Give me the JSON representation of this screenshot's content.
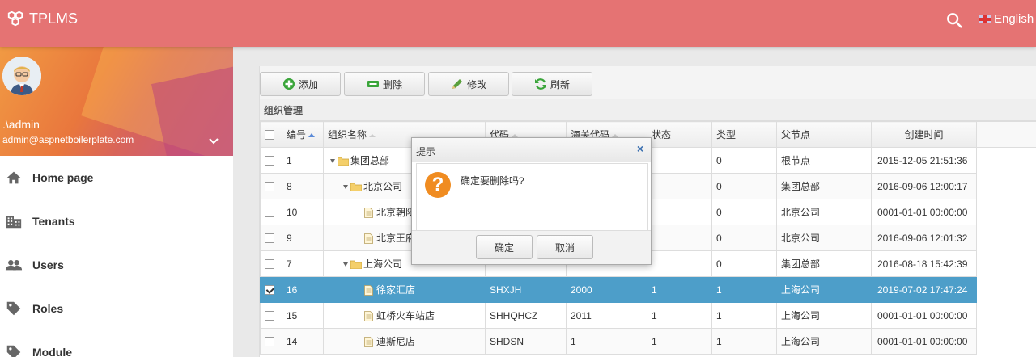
{
  "topbar": {
    "app_title": "TPLMS",
    "language": "English"
  },
  "user": {
    "name": ".\\admin",
    "email": "admin@aspnetboilerplate.com"
  },
  "menu": [
    {
      "label": "Home page",
      "icon": "home-icon"
    },
    {
      "label": "Tenants",
      "icon": "building-icon"
    },
    {
      "label": "Users",
      "icon": "users-icon"
    },
    {
      "label": "Roles",
      "icon": "tag-icon"
    },
    {
      "label": "Module",
      "icon": "tag-icon"
    }
  ],
  "toolbar": {
    "add": "添加",
    "delete": "删除",
    "edit": "修改",
    "refresh": "刷新"
  },
  "panel_title": "组织管理",
  "grid": {
    "columns": [
      "编号",
      "组织名称",
      "代码",
      "海关代码",
      "状态",
      "类型",
      "父节点",
      "创建时间"
    ],
    "rows": [
      {
        "id": "1",
        "name": "集团总部",
        "code": "",
        "customs": "",
        "status": "",
        "type": "0",
        "parent": "根节点",
        "created": "2015-12-05 21:51:36",
        "checked": false
      },
      {
        "id": "8",
        "name": "北京公司",
        "code": "",
        "customs": "",
        "status": "",
        "type": "0",
        "parent": "集团总部",
        "created": "2016-09-06 12:00:17",
        "checked": false
      },
      {
        "id": "10",
        "name": "北京朝阳",
        "code": "",
        "customs": "",
        "status": "",
        "type": "0",
        "parent": "北京公司",
        "created": "0001-01-01 00:00:00",
        "checked": false
      },
      {
        "id": "9",
        "name": "北京王府",
        "code": "",
        "customs": "",
        "status": "",
        "type": "0",
        "parent": "北京公司",
        "created": "2016-09-06 12:01:32",
        "checked": false
      },
      {
        "id": "7",
        "name": "上海公司",
        "code": "",
        "customs": "",
        "status": "",
        "type": "0",
        "parent": "集团总部",
        "created": "2016-08-18 15:42:39",
        "checked": false
      },
      {
        "id": "16",
        "name": "徐家汇店",
        "code": "SHXJH",
        "customs": "2000",
        "status": "1",
        "type": "1",
        "parent": "上海公司",
        "created": "2019-07-02 17:47:24",
        "checked": true
      },
      {
        "id": "15",
        "name": "虹桥火车站店",
        "code": "SHHQHCZ",
        "customs": "2011",
        "status": "1",
        "type": "1",
        "parent": "上海公司",
        "created": "0001-01-01 00:00:00",
        "checked": false
      },
      {
        "id": "14",
        "name": "迪斯尼店",
        "code": "SHDSN",
        "customs": "1",
        "status": "1",
        "type": "1",
        "parent": "上海公司",
        "created": "0001-01-01 00:00:00",
        "checked": false
      }
    ]
  },
  "dialog": {
    "title": "提示",
    "message": "确定要删除吗?",
    "ok": "确定",
    "cancel": "取消"
  },
  "colors": {
    "topbar": "#e57373",
    "selected_row": "#4d9ec9",
    "question_icon": "#f08c21"
  }
}
